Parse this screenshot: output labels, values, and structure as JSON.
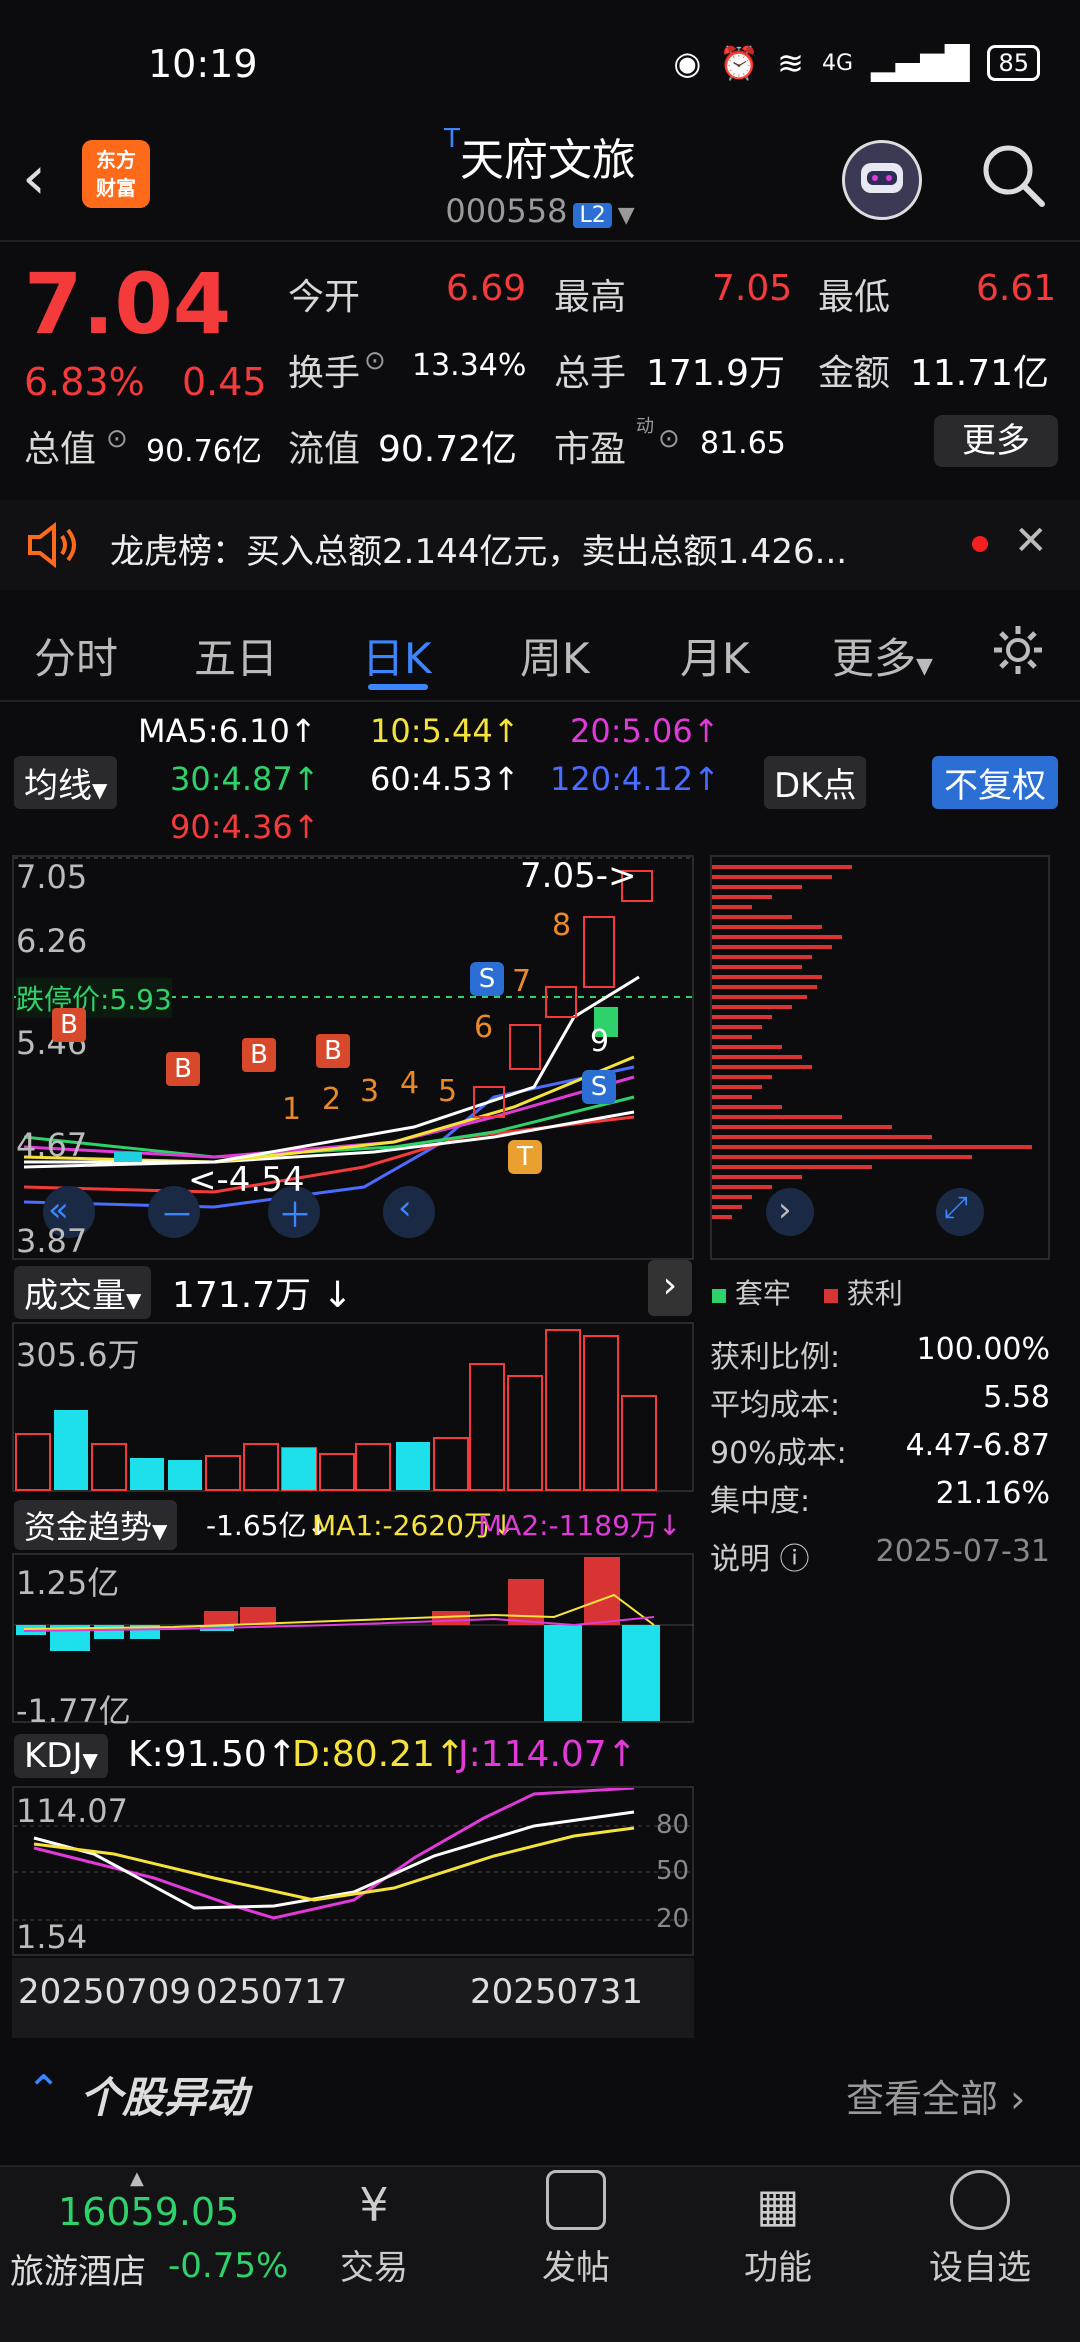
{
  "status": {
    "time": "10:19",
    "battery": "85",
    "network": "4G"
  },
  "header": {
    "logo_line1": "东方",
    "logo_line2": "财富",
    "t_badge": "T",
    "stock_name": "天府文旅",
    "stock_code": "000558",
    "l2_badge": "L2"
  },
  "quote": {
    "price": "7.04",
    "change_pct": "6.83%",
    "change": "0.45",
    "open_label": "今开",
    "open": "6.69",
    "high_label": "最高",
    "high": "7.05",
    "low_label": "最低",
    "low": "6.61",
    "turnover_label": "换手",
    "turnover": "13.34%",
    "volume_label": "总手",
    "volume": "171.9万",
    "amount_label": "金额",
    "amount": "11.71亿",
    "mktcap_label": "总值",
    "mktcap": "90.76亿",
    "float_label": "流值",
    "float": "90.72亿",
    "pe_label": "市盈",
    "pe_sup": "动",
    "pe": "81.65",
    "more_label": "更多"
  },
  "banner": {
    "text": "龙虎榜：买入总额2.144亿元，卖出总额1.426..."
  },
  "tabs": [
    {
      "label": "分时",
      "active": false
    },
    {
      "label": "五日",
      "active": false
    },
    {
      "label": "日K",
      "active": true
    },
    {
      "label": "周K",
      "active": false
    },
    {
      "label": "月K",
      "active": false
    },
    {
      "label": "更多",
      "active": false
    }
  ],
  "ma_bar": {
    "select": "均线",
    "ma5": "MA5:6.10↑",
    "ma10": "10:5.44↑",
    "ma20": "20:5.06↑",
    "ma30": "30:4.87↑",
    "ma60": "60:4.53↑",
    "ma120": "120:4.12↑",
    "ma90": "90:4.36↑",
    "dk": "DK点",
    "adjust": "不复权",
    "colors": {
      "ma5": "#ffffff",
      "ma10": "#f5e33b",
      "ma20": "#e03ad8",
      "ma30": "#2fd16b",
      "ma60": "#ffffff",
      "ma120": "#4a6cff",
      "ma90": "#f43a3a"
    }
  },
  "kline": {
    "y_top": "7.05",
    "y2": "6.26",
    "y3": "5.46",
    "y4": "4.67",
    "y_bottom": "3.87",
    "limit_down": "跌停价:5.93",
    "high_marker": "7.05->",
    "low_marker": "<-4.54",
    "buy_markers": [
      "B",
      "B",
      "B",
      "B"
    ],
    "sell_markers": [
      "S",
      "S"
    ],
    "t_marker": "T",
    "count_markers": [
      "1",
      "2",
      "3",
      "4",
      "5",
      "6",
      "7",
      "8",
      "9"
    ]
  },
  "chip": {
    "legend_stable": "套牢",
    "legend_profit": "获利",
    "rows": [
      {
        "label": "获利比例:",
        "value": "100.00%"
      },
      {
        "label": "平均成本:",
        "value": "5.58"
      },
      {
        "label": "90%成本:",
        "value": "4.47-6.87"
      },
      {
        "label": "集中度:",
        "value": "21.16%"
      }
    ],
    "note_label": "说明",
    "date": "2025-07-31"
  },
  "volume": {
    "select": "成交量",
    "value": "171.7万 ↓",
    "max": "305.6万"
  },
  "funds": {
    "select": "资金趋势",
    "value": "-1.65亿↓",
    "ma1": "MA1:-2620万↓",
    "ma2": "MA2:-1189万↓",
    "top": "1.25亿",
    "bottom": "-1.77亿"
  },
  "kdj": {
    "select": "KDJ",
    "k": "K:91.50↑",
    "d": "D:80.21↑",
    "j": "J:114.07↑",
    "top": "114.07",
    "bottom": "1.54",
    "l80": "80",
    "l50": "50",
    "l20": "20"
  },
  "dates": [
    "20250709",
    "0250717",
    "20250731"
  ],
  "movement": {
    "title": "个股异动",
    "link": "查看全部"
  },
  "nav": {
    "index_value": "16059.05",
    "index_name": "旅游酒店",
    "index_change": "-0.75%",
    "items": [
      "交易",
      "发帖",
      "功能",
      "设自选"
    ]
  }
}
